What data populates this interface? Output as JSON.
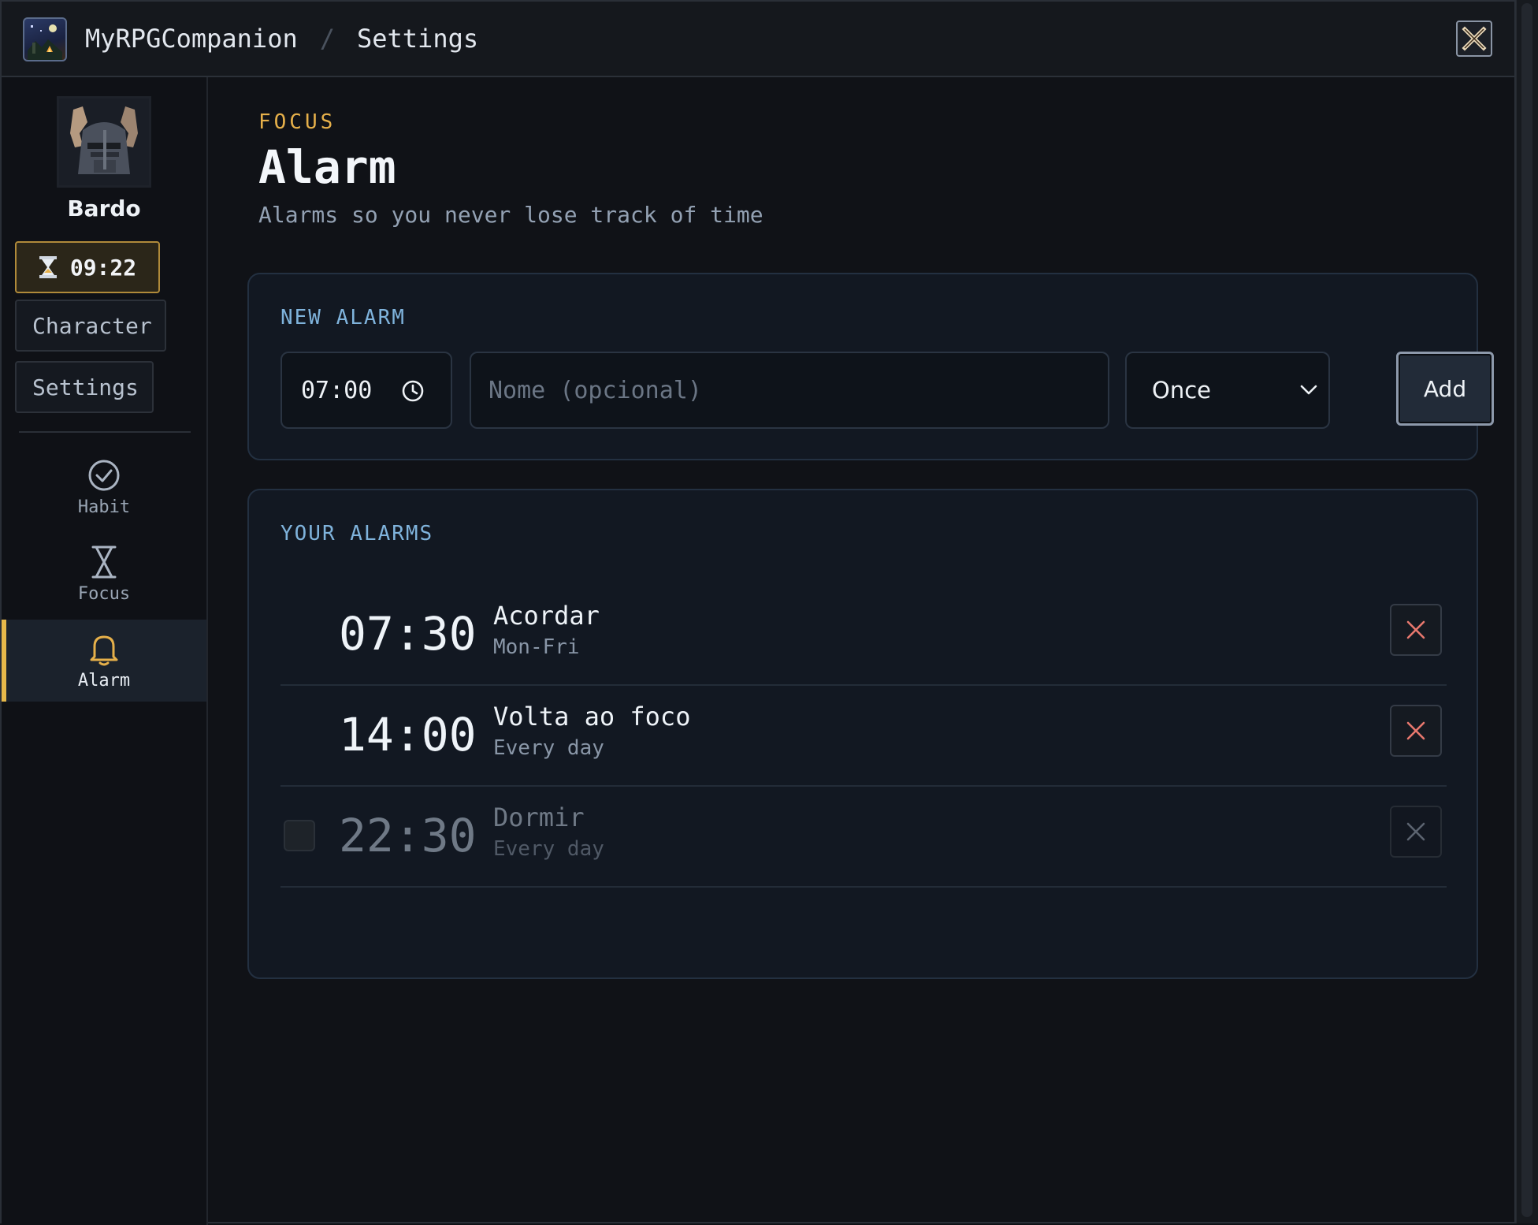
{
  "titlebar": {
    "app_name": "MyRPGCompanion",
    "separator": "/",
    "breadcrumb": "Settings"
  },
  "sidebar": {
    "character_name": "Bardo",
    "timer": "09:22",
    "character_button": "Character",
    "settings_button": "Settings",
    "nav": [
      {
        "label": "Habit",
        "icon": "check-circle-icon"
      },
      {
        "label": "Focus",
        "icon": "hourglass-icon"
      },
      {
        "label": "Alarm",
        "icon": "bell-icon",
        "active": true
      }
    ]
  },
  "header": {
    "eyebrow": "FOCUS",
    "title": "Alarm",
    "subtitle": "Alarms so you never lose track of time"
  },
  "new_alarm": {
    "label": "NEW ALARM",
    "time_value": "07:00",
    "name_placeholder": "Nome (opcional)",
    "repeat_selected": "Once",
    "add_label": "Add"
  },
  "alarms": {
    "label": "YOUR ALARMS",
    "items": [
      {
        "time": "07:30",
        "name": "Acordar",
        "repeat": "Mon-Fri",
        "enabled": true
      },
      {
        "time": "14:00",
        "name": "Volta ao foco",
        "repeat": "Every day",
        "enabled": true
      },
      {
        "time": "22:30",
        "name": "Dormir",
        "repeat": "Every day",
        "enabled": false
      }
    ]
  },
  "colors": {
    "accent": "#e6b04a",
    "section_label": "#7fb3dc",
    "delete_x": "#e8786e"
  }
}
